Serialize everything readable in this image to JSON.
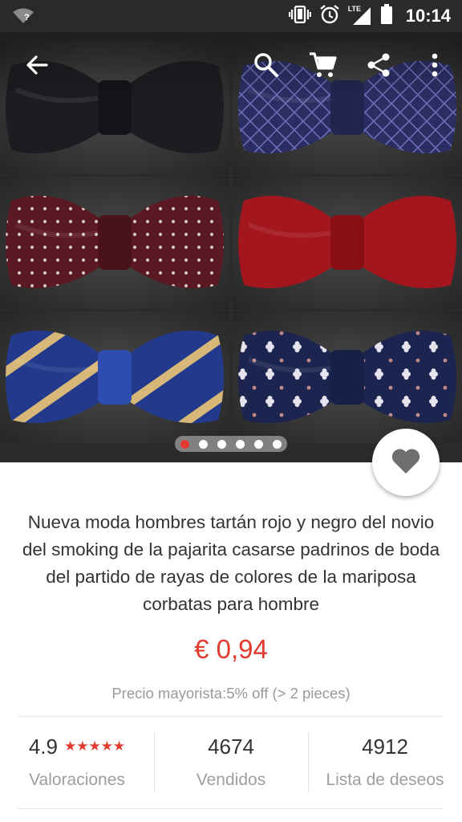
{
  "status_bar": {
    "time": "10:14",
    "network": "LTE",
    "wifi_badge": "?",
    "icons": [
      "wifi-unknown-icon",
      "vibrate-icon",
      "alarm-icon",
      "signal-icon",
      "battery-icon"
    ]
  },
  "toolbar": {
    "icons": [
      "back-arrow-icon",
      "search-icon",
      "cart-icon",
      "share-icon",
      "more-vert-icon"
    ]
  },
  "gallery": {
    "current_page": 1,
    "page_count": 6,
    "tiles": [
      {
        "name": "black-bow-tie",
        "base": "#1c1d20",
        "knot": "#141518",
        "pattern": "none",
        "accent": "#2c2d31"
      },
      {
        "name": "navy-lattice-bow-tie",
        "base": "#2b2e63",
        "knot": "#22264f",
        "pattern": "lattice",
        "accent": "#6a6bb5"
      },
      {
        "name": "burgundy-dot-bow-tie",
        "base": "#5b1a23",
        "knot": "#4a131b",
        "pattern": "dots",
        "accent": "#d9c7c0"
      },
      {
        "name": "red-bow-tie",
        "base": "#a4161d",
        "knot": "#8a0f15",
        "pattern": "none",
        "accent": "#c82a2f"
      },
      {
        "name": "navy-gold-stripe-bow-tie",
        "base": "#233a8c",
        "knot": "#2f4db0",
        "pattern": "stripes",
        "accent": "#d8b878"
      },
      {
        "name": "navy-floral-bow-tie",
        "base": "#1c2550",
        "knot": "#172046",
        "pattern": "flowers",
        "accent": "#e6e2ee"
      }
    ]
  },
  "colors": {
    "accent": "#e23a2e",
    "status_bar": "#2a2a2a"
  },
  "product": {
    "title": "Nueva moda hombres tartán rojo y negro del novio del smoking de la pajarita casarse padrinos de boda del partido de rayas de colores de la mariposa corbatas para hombre",
    "price": "€ 0,94",
    "wholesale": "Precio mayorista:5% off (> 2 pieces)"
  },
  "stats": [
    {
      "value": "4.9",
      "stars": "★★★★★",
      "label": "Valoraciones"
    },
    {
      "value": "4674",
      "label": "Vendidos"
    },
    {
      "value": "4912",
      "label": "Lista de deseos"
    }
  ]
}
